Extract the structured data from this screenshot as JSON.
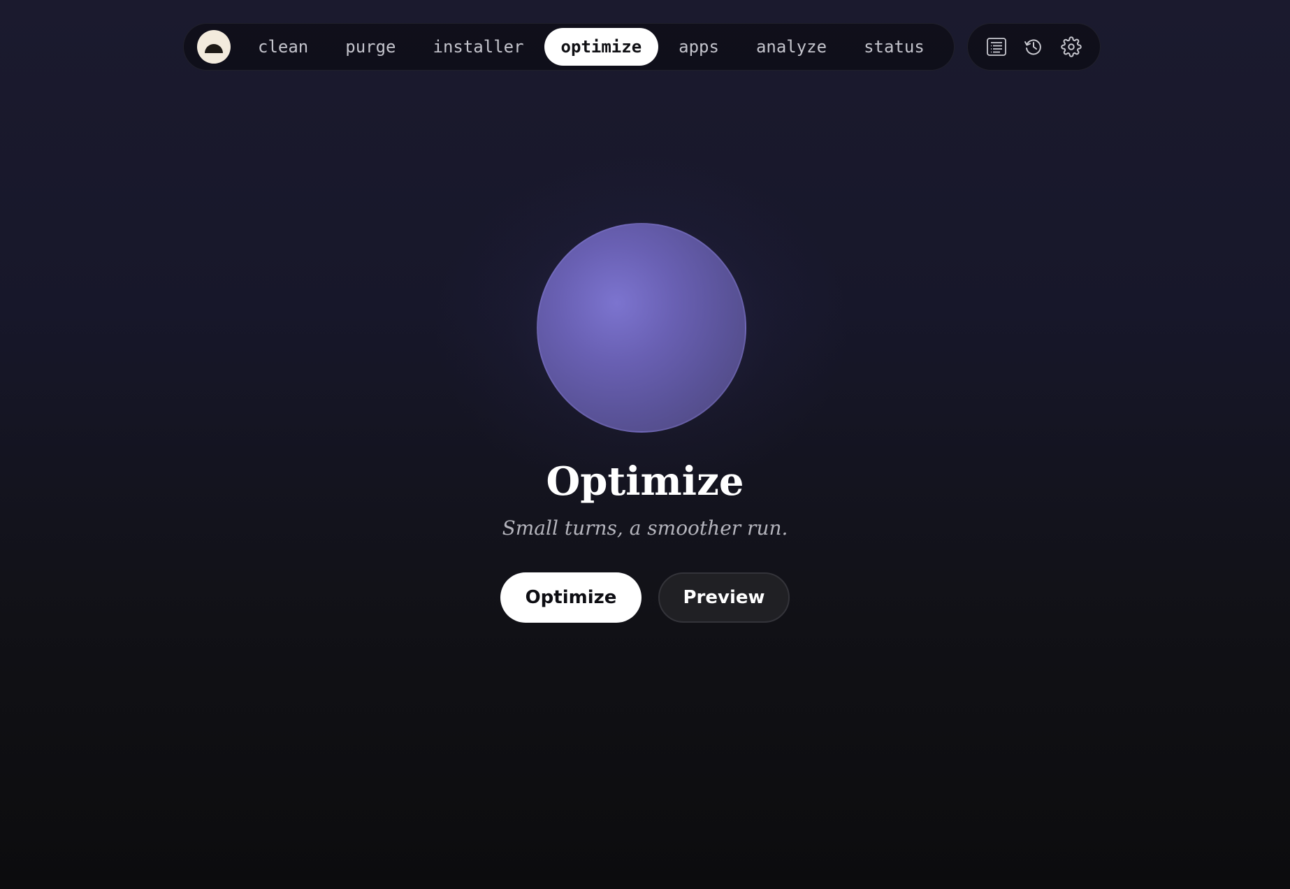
{
  "nav": {
    "tabs": [
      {
        "label": "clean",
        "active": false
      },
      {
        "label": "purge",
        "active": false
      },
      {
        "label": "installer",
        "active": false
      },
      {
        "label": "optimize",
        "active": true
      },
      {
        "label": "apps",
        "active": false
      },
      {
        "label": "analyze",
        "active": false
      },
      {
        "label": "status",
        "active": false
      }
    ]
  },
  "tools": {
    "icons": [
      "log-icon",
      "history-icon",
      "gear-icon"
    ]
  },
  "hero": {
    "title": "Optimize",
    "subtitle": "Small turns, a smoother run.",
    "primary_button": "Optimize",
    "secondary_button": "Preview"
  },
  "colors": {
    "orb": "#6960b3",
    "active_tab_bg": "#ffffff",
    "background": "#17172a"
  }
}
